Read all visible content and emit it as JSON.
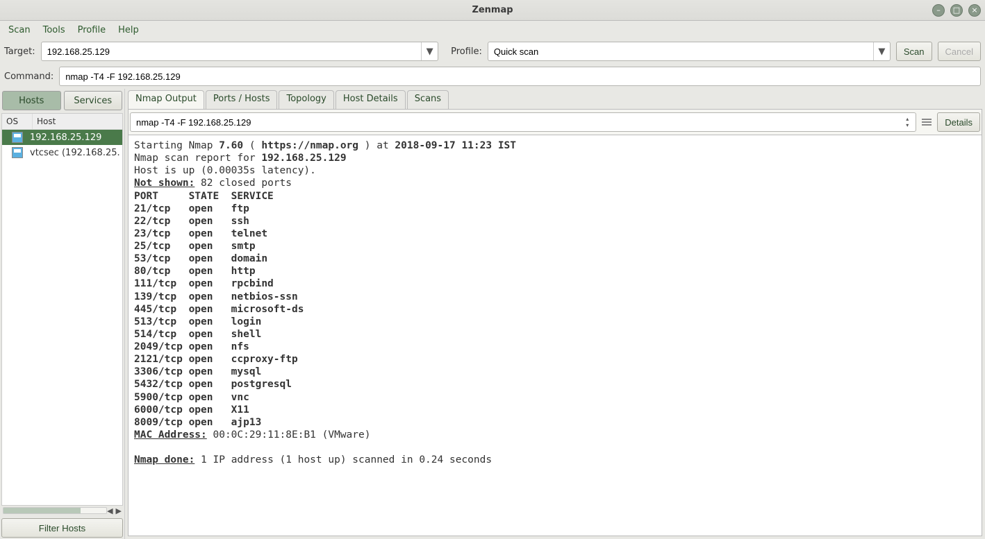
{
  "window": {
    "title": "Zenmap"
  },
  "menu": {
    "scan": "Scan",
    "tools": "Tools",
    "profile": "Profile",
    "help": "Help"
  },
  "toolbar": {
    "target_label": "Target:",
    "target_value": "192.168.25.129",
    "profile_label": "Profile:",
    "profile_value": "Quick scan",
    "scan_btn": "Scan",
    "cancel_btn": "Cancel",
    "command_label": "Command:",
    "command_value": "nmap -T4 -F 192.168.25.129"
  },
  "sidebar": {
    "hosts_tab": "Hosts",
    "services_tab": "Services",
    "col_os": "OS",
    "col_host": "Host",
    "rows": [
      {
        "host": "192.168.25.129",
        "selected": true
      },
      {
        "host": "vtcsec (192.168.25.",
        "selected": false
      }
    ],
    "filter_btn": "Filter Hosts"
  },
  "tabs": {
    "output": "Nmap Output",
    "ports": "Ports / Hosts",
    "topology": "Topology",
    "hostdetails": "Host Details",
    "scans": "Scans"
  },
  "output_bar": {
    "command": "nmap -T4 -F 192.168.25.129",
    "details_btn": "Details"
  },
  "nmap": {
    "version": "7.60",
    "url": "https://nmap.org",
    "start_time": "2018-09-17 11:23 IST",
    "target": "192.168.25.129",
    "latency": "0.00035s",
    "not_shown": "82 closed ports",
    "header": "PORT     STATE  SERVICE",
    "ports": [
      {
        "port": "21/tcp",
        "state": "open",
        "service": "ftp"
      },
      {
        "port": "22/tcp",
        "state": "open",
        "service": "ssh"
      },
      {
        "port": "23/tcp",
        "state": "open",
        "service": "telnet"
      },
      {
        "port": "25/tcp",
        "state": "open",
        "service": "smtp"
      },
      {
        "port": "53/tcp",
        "state": "open",
        "service": "domain"
      },
      {
        "port": "80/tcp",
        "state": "open",
        "service": "http"
      },
      {
        "port": "111/tcp",
        "state": "open",
        "service": "rpcbind"
      },
      {
        "port": "139/tcp",
        "state": "open",
        "service": "netbios-ssn"
      },
      {
        "port": "445/tcp",
        "state": "open",
        "service": "microsoft-ds"
      },
      {
        "port": "513/tcp",
        "state": "open",
        "service": "login"
      },
      {
        "port": "514/tcp",
        "state": "open",
        "service": "shell"
      },
      {
        "port": "2049/tcp",
        "state": "open",
        "service": "nfs"
      },
      {
        "port": "2121/tcp",
        "state": "open",
        "service": "ccproxy-ftp"
      },
      {
        "port": "3306/tcp",
        "state": "open",
        "service": "mysql"
      },
      {
        "port": "5432/tcp",
        "state": "open",
        "service": "postgresql"
      },
      {
        "port": "5900/tcp",
        "state": "open",
        "service": "vnc"
      },
      {
        "port": "6000/tcp",
        "state": "open",
        "service": "X11"
      },
      {
        "port": "8009/tcp",
        "state": "open",
        "service": "ajp13"
      }
    ],
    "mac": "00:0C:29:11:8E:B1 (VMware)",
    "done": "1 IP address (1 host up) scanned in 0.24 seconds"
  }
}
